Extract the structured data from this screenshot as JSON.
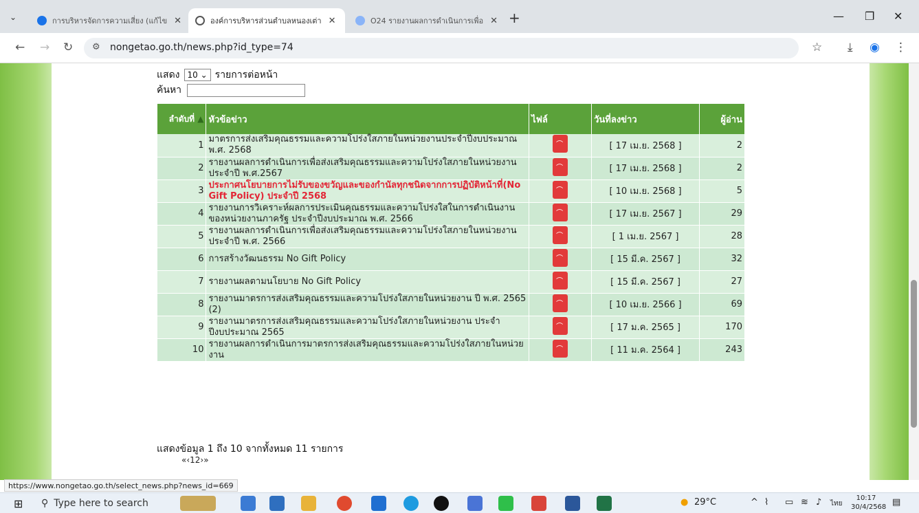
{
  "browser": {
    "tabs": [
      {
        "title": "การบริหารจัดการความเสี่ยง (แก้ไข",
        "fav": "#1a73e8"
      },
      {
        "title": "องค์การบริหารส่วนตำบลหนองเต่า",
        "fav": "#555"
      },
      {
        "title": "O24 รายงานผลการดำเนินการเพื่อ",
        "fav": "#8ab4f8"
      }
    ],
    "url": "nongetao.go.th/news.php?id_type=74"
  },
  "page": {
    "show_label": "แสดง",
    "show_value": "10",
    "per_page_label": "รายการต่อหน้า",
    "search_label": "ค้นหา",
    "columns": [
      "ลำดับที่",
      "หัวข้อข่าว",
      "ไฟล์",
      "วันที่ลงข่าว",
      "ผู้อ่าน"
    ],
    "rows": [
      {
        "num": "1",
        "title": "มาตรการส่งเสริมคุณธรรมและความโปร่งใสภายในหน่วยงานประจำปีงบประมาณ พ.ศ. 2568",
        "date": "[ 17 เม.ย. 2568 ]",
        "reads": "2"
      },
      {
        "num": "2",
        "title": "รายงานผลการดำเนินการเพื่อส่งเสริมคุณธรรมและความโปร่งใสภายในหน่วยงานประจำปี พ.ศ.2567",
        "date": "[ 17 เม.ย. 2568 ]",
        "reads": "2"
      },
      {
        "num": "3",
        "title": "ประกาศนโยบายการไม่รับของขวัญและของกำนัลทุกชนิดจากการปฏิบัติหน้าที่(No Gift Policy) ประจำปี 2568",
        "date": "[ 10 เม.ย. 2568 ]",
        "reads": "5"
      },
      {
        "num": "4",
        "title": "รายงานการวิเคราะห์ผลการประเมินคุณธรรมและความโปร่งใสในการดำเนินงานของหน่วยงานภาครัฐ ประจำปีงบประมาณ พ.ศ. 2566",
        "date": "[ 17 เม.ย. 2567 ]",
        "reads": "29"
      },
      {
        "num": "5",
        "title": "รายงานผลการดำเนินการเพื่อส่งเสริมคุณธรรมและความโปร่งใสภายในหน่วยงาน ประจำปี พ.ศ. 2566",
        "date": "[ 1 เม.ย. 2567 ]",
        "reads": "28"
      },
      {
        "num": "6",
        "title": "การสร้างวัฒนธรรม No Gift Policy",
        "date": "[ 15 มี.ค. 2567 ]",
        "reads": "32"
      },
      {
        "num": "7",
        "title": "รายงานผลตามนโยบาย No Gift Policy",
        "date": "[ 15 มี.ค. 2567 ]",
        "reads": "27"
      },
      {
        "num": "8",
        "title": "รายงานมาตรการส่งเสริมคุณธรรมและความโปร่งใสภายในหน่วยงาน ปี พ.ศ. 2565 (2)",
        "date": "[ 10 เม.ย. 2566 ]",
        "reads": "69"
      },
      {
        "num": "9",
        "title": "รายงานมาตรการส่งเสริมคุณธรรมและความโปร่งใสภายในหน่วยงาน ประจำปีงบประมาณ 2565",
        "date": "[ 17 ม.ค. 2565 ]",
        "reads": "170"
      },
      {
        "num": "10",
        "title": "รายงานผลการดำเนินการมาตรการส่งเสริมคุณธรรมและความโปร่งใสภายในหน่วยงาน",
        "date": "[ 11 ม.ค. 2564 ]",
        "reads": "243"
      }
    ],
    "info": "แสดงข้อมูล 1 ถึง 10 จากทั้งหมด 11 รายการ",
    "pager": "«‹12›»",
    "status_url": "https://www.nongetao.go.th/select_news.php?news_id=669"
  },
  "taskbar": {
    "search_placeholder": "Type here to search",
    "weather": "29°C",
    "lang": "ไทย",
    "time": "10:17",
    "date": "30/4/2568"
  }
}
